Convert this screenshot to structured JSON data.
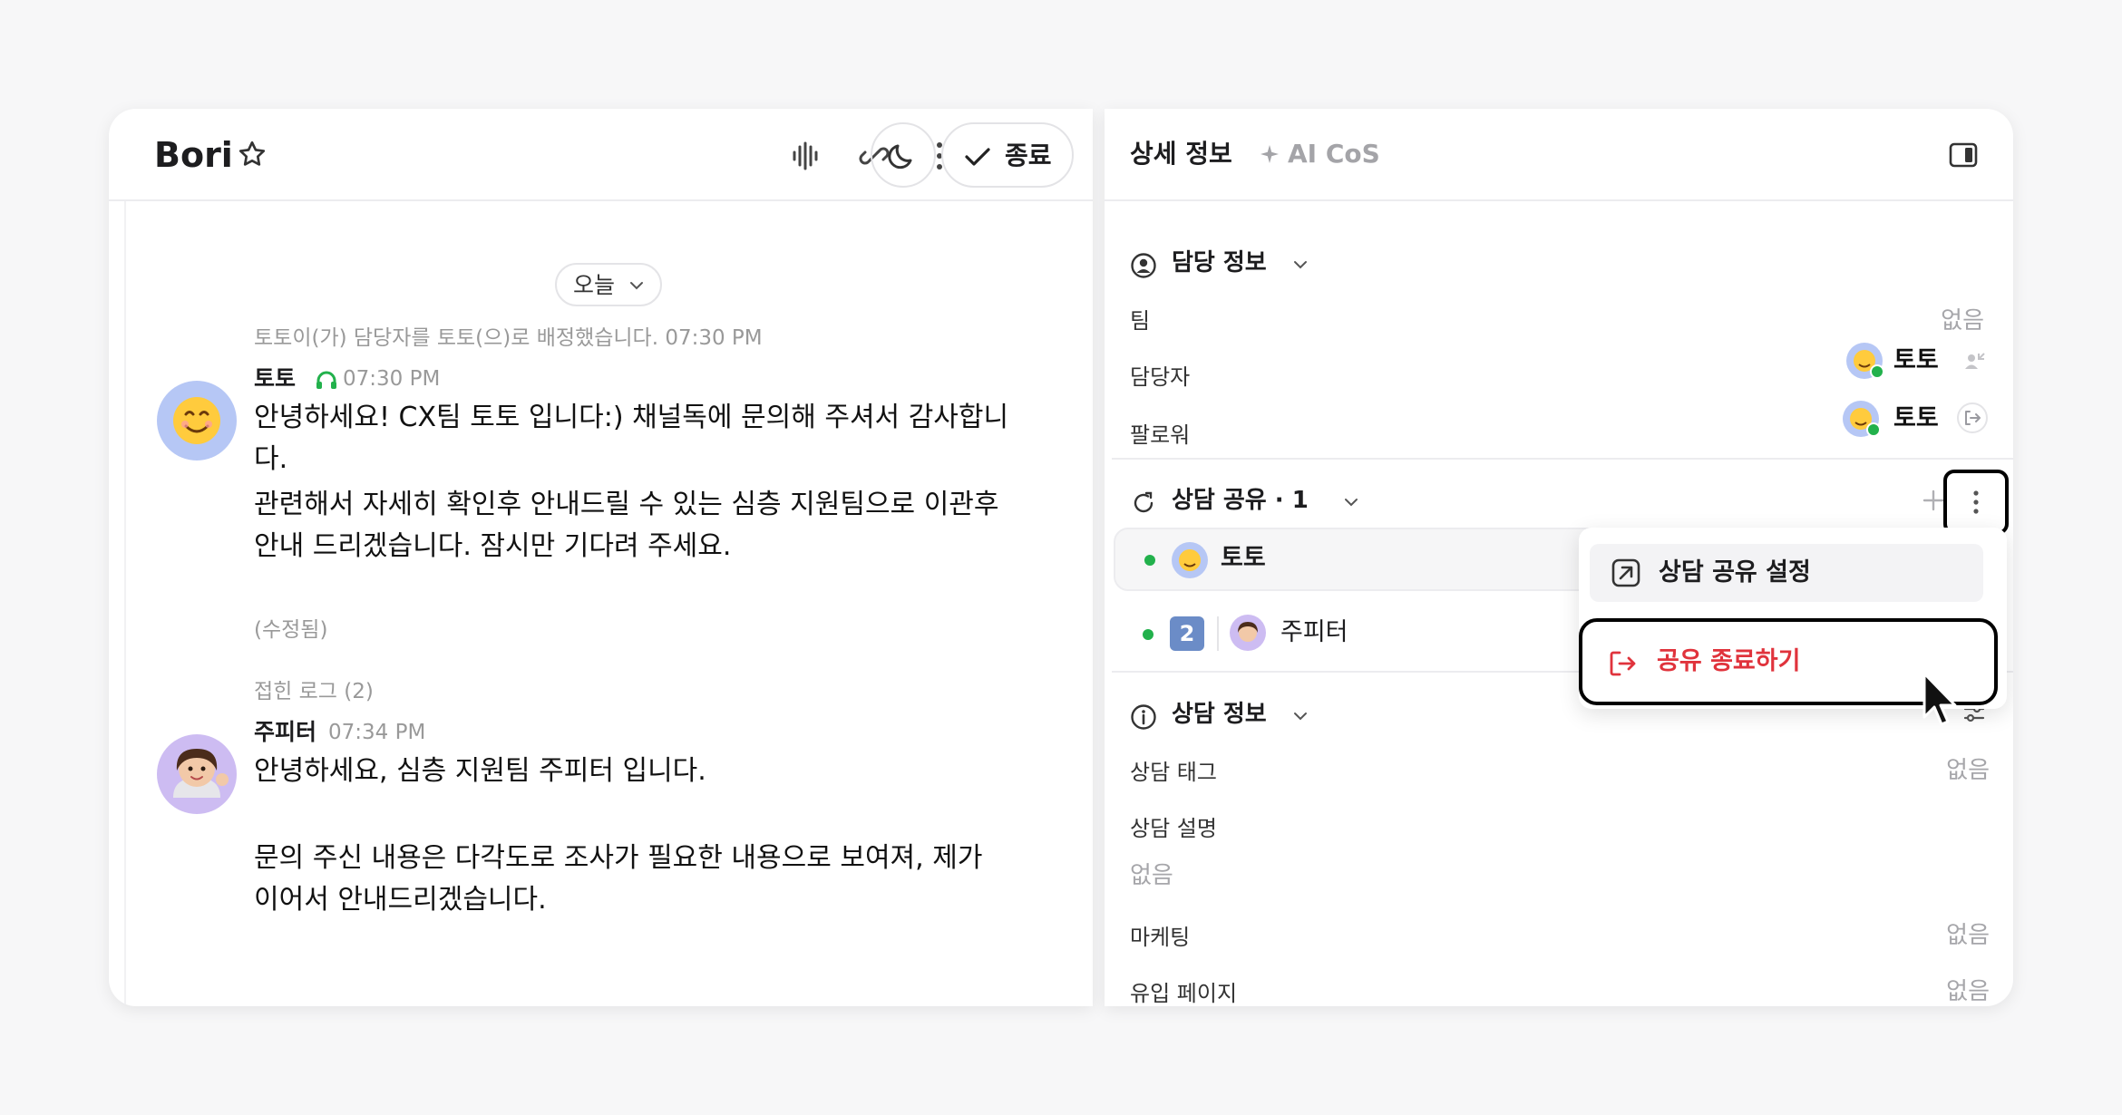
{
  "chat": {
    "title": "Bori",
    "end_label": "종료",
    "date_pill": "오늘",
    "system_message": "토토이(가) 담당자를 토토(으)로 배정했습니다. 07:30 PM",
    "messages": [
      {
        "name": "토토",
        "time": "07:30 PM",
        "text1": "안녕하세요! CX팀 토토 입니다:) 채널독에 문의해 주셔서 감사합니다.",
        "text2": "관련해서 자세히 확인후 안내드릴 수 있는 심층 지원팀으로 이관후 안내 드리겠습니다. 잠시만 기다려 주세요.",
        "edited": "(수정됨)"
      },
      {
        "name": "주피터",
        "time": "07:34 PM",
        "text1": "안녕하세요, 심층 지원팀 주피터 입니다.",
        "text2": "문의 주신 내용은 다각도로 조사가 필요한 내용으로 보여져, 제가 이어서 안내드리겠습니다."
      }
    ],
    "folded_log": "접힌 로그 (2)"
  },
  "side": {
    "tabs": [
      "상세 정보",
      "AI CoS"
    ],
    "assignment": {
      "title": "담당 정보",
      "team_label": "팀",
      "team_value": "없음",
      "assignee_label": "담당자",
      "assignee_value": "토토",
      "follower_label": "팔로워",
      "follower_value": "토토"
    },
    "share": {
      "title": "상담 공유 · 1",
      "rows": [
        {
          "name": "토토"
        },
        {
          "badge": "2",
          "name": "주피터"
        }
      ],
      "menu": {
        "settings": "상담 공유 설정",
        "end_share": "공유 종료하기"
      }
    },
    "consult": {
      "title": "상담 정보",
      "tag_label": "상담 태그",
      "tag_value": "없음",
      "desc_label": "상담 설명",
      "desc_value": "없음",
      "marketing_label": "마케팅",
      "marketing_value": "없음",
      "inflow_label": "유입 페이지",
      "inflow_value": "없음"
    }
  },
  "colors": {
    "accent_red": "#e0333c",
    "online_green": "#22b14c",
    "muted": "#a6a6aa"
  }
}
